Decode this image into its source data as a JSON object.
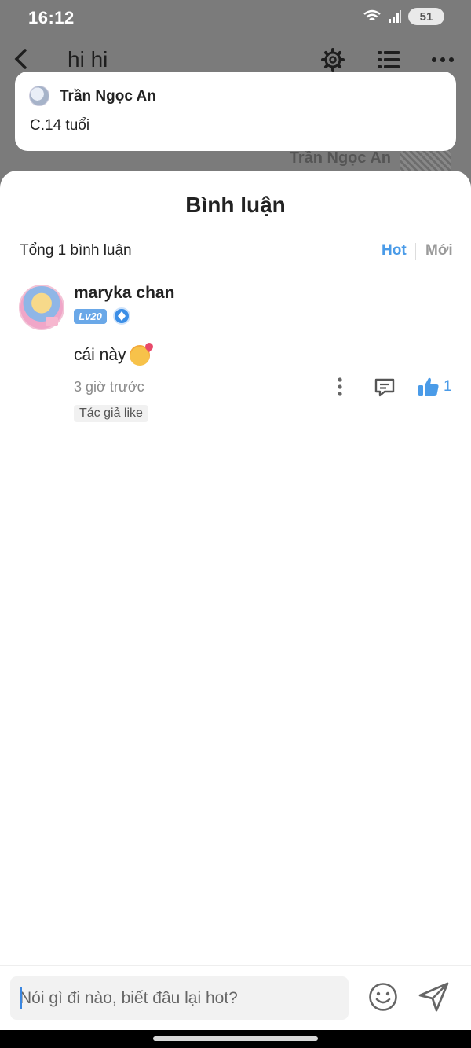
{
  "status_bar": {
    "time": "16:12",
    "battery": "51"
  },
  "header": {
    "title": "hi hi"
  },
  "background": {
    "author_name": "Trần Ngọc An"
  },
  "notification": {
    "name": "Trần Ngọc An",
    "message": "C.14 tuổi"
  },
  "sheet": {
    "title": "Bình luận",
    "total_label": "Tổng 1 bình luận",
    "sort_hot": "Hot",
    "sort_new": "Mới"
  },
  "comments": [
    {
      "username": "maryka chan",
      "level": "Lv20",
      "text": "cái này",
      "time": "3 giờ trước",
      "likes": "1",
      "author_like": "Tác giả like"
    }
  ],
  "input": {
    "placeholder": "Nói gì đi nào, biết đâu lại hot?"
  },
  "colors": {
    "accent": "#4a9be8",
    "level_badge": "#6aa8e8"
  }
}
